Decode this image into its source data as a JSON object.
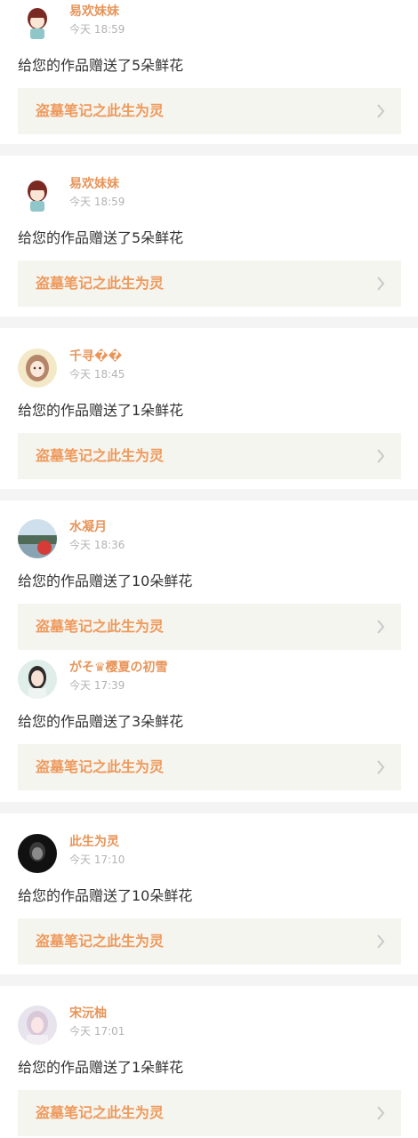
{
  "work_title": "盗墓笔记之此生为灵",
  "items": [
    {
      "user": "易欢妹妹",
      "time": "今天 18:59",
      "message": "给您的作品赠送了5朵鲜花",
      "avatar": "cartoon-boy-avatar"
    },
    {
      "user": "易欢妹妹",
      "time": "今天 18:59",
      "message": "给您的作品赠送了5朵鲜花",
      "avatar": "cartoon-boy-avatar"
    },
    {
      "user": "千寻��",
      "time": "今天 18:45",
      "message": "给您的作品赠送了1朵鲜花",
      "avatar": "anime-girl-avatar"
    },
    {
      "user": "水凝月",
      "time": "今天 18:36",
      "message": "给您的作品赠送了10朵鲜花",
      "avatar": "landscape-photo-avatar"
    },
    {
      "user": "がそ♛樱夏の初雪",
      "time": "今天 17:39",
      "message": "给您的作品赠送了3朵鲜花",
      "avatar": "girl-photo-avatar"
    },
    {
      "user": "此生为灵",
      "time": "今天 17:10",
      "message": "给您的作品赠送了10朵鲜花",
      "avatar": "dark-portrait-avatar"
    },
    {
      "user": "宋沅柚",
      "time": "今天 17:01",
      "message": "给您的作品赠送了1朵鲜花",
      "avatar": "girl-photo-avatar"
    }
  ],
  "colors": {
    "username": "#e8955a",
    "work_title": "#ee9a5d",
    "card_bg": "#f5f5ef",
    "separator": "#f4f4f4"
  }
}
